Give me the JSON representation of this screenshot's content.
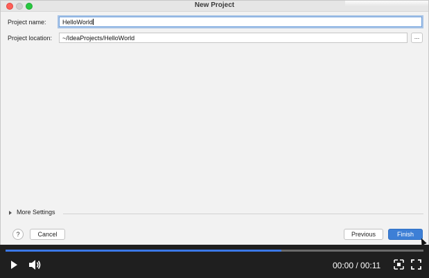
{
  "window": {
    "title": "New Project"
  },
  "form": {
    "project_name_label": "Project name:",
    "project_name_value": "HelloWorld",
    "project_location_label": "Project location:",
    "project_location_value": "~/IdeaProjects/HelloWorld",
    "browse_label": "..."
  },
  "more_settings": {
    "label": "More Settings"
  },
  "footer": {
    "help_label": "?",
    "cancel_label": "Cancel",
    "previous_label": "Previous",
    "finish_label": "Finish"
  },
  "player": {
    "current_time": "00:00",
    "separator": " / ",
    "duration": "00:11",
    "progress": 0.66,
    "accent_color": "#3b78e7"
  },
  "colors": {
    "primary_button": "#3d7fd6",
    "close": "#fe5f57",
    "zoom": "#28c840"
  },
  "icons": {
    "play": "play-icon",
    "volume": "volume-icon",
    "pip": "picture-in-picture-icon",
    "fullscreen": "fullscreen-icon",
    "help": "help-icon",
    "disclosure": "chevron-right-icon"
  }
}
